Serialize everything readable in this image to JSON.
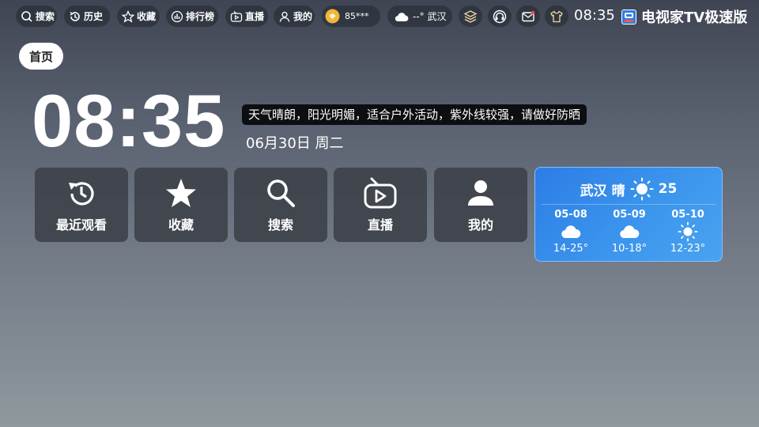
{
  "topbar": {
    "items": [
      {
        "label": "搜索",
        "icon": "search-icon"
      },
      {
        "label": "历史",
        "icon": "history-icon"
      },
      {
        "label": "收藏",
        "icon": "star-icon"
      },
      {
        "label": "排行榜",
        "icon": "ranking-icon"
      },
      {
        "label": "直播",
        "icon": "live-tv-icon"
      },
      {
        "label": "我的",
        "icon": "user-icon"
      }
    ],
    "account": "85***",
    "weather": "--° 武汉",
    "clock": "08:35",
    "brand": "电视家TV极速版"
  },
  "home_tab": "首页",
  "main": {
    "time": "08:35",
    "tip": "天气晴朗，阳光明媚，适合户外活动，紫外线较强，请做好防晒",
    "date": "06月30日 周二"
  },
  "tiles": [
    {
      "label": "最近观看",
      "icon": "history-icon"
    },
    {
      "label": "收藏",
      "icon": "star-icon"
    },
    {
      "label": "搜索",
      "icon": "search-icon"
    },
    {
      "label": "直播",
      "icon": "live-tv-icon"
    },
    {
      "label": "我的",
      "icon": "user-icon"
    }
  ],
  "weather_card": {
    "city": "武汉",
    "condition": "晴",
    "temp": "25",
    "forecast": [
      {
        "date": "05-08",
        "icon": "cloud-icon",
        "temp": "14-25°"
      },
      {
        "date": "05-09",
        "icon": "cloud-icon",
        "temp": "10-18°"
      },
      {
        "date": "05-10",
        "icon": "sun-icon",
        "temp": "12-23°"
      }
    ]
  }
}
